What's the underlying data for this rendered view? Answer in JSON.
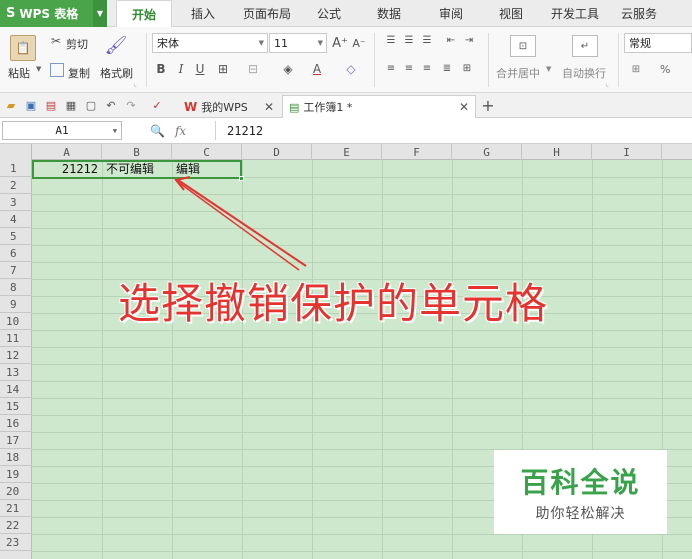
{
  "app": {
    "name": "WPS 表格",
    "logo": "S"
  },
  "menu_tabs": [
    "开始",
    "插入",
    "页面布局",
    "公式",
    "数据",
    "审阅",
    "视图",
    "开发工具",
    "云服务"
  ],
  "ribbon": {
    "cut": "剪切",
    "copy": "复制",
    "paste": "粘贴",
    "format_painter": "格式刷",
    "font_name": "宋体",
    "font_size": "11",
    "merge_center": "合并居中",
    "wrap_text": "自动换行",
    "number_format": "常规",
    "percent": "%"
  },
  "doc_tabs": [
    {
      "label": "我的WPS"
    },
    {
      "label": "工作簿1 *"
    }
  ],
  "formula_bar": {
    "name_box": "A1",
    "fx": "fx",
    "value": "21212"
  },
  "columns": [
    "A",
    "B",
    "C",
    "D",
    "E",
    "F",
    "G",
    "H",
    "I"
  ],
  "rows": [
    "1",
    "2",
    "3",
    "4",
    "5",
    "6",
    "7",
    "8",
    "9",
    "10",
    "11",
    "12",
    "13",
    "14",
    "15",
    "16",
    "17",
    "18",
    "19",
    "20",
    "21",
    "22",
    "23"
  ],
  "cells": {
    "A1": "21212",
    "B1": "不可编辑",
    "C1": "编辑"
  },
  "annotation": "选择撤销保护的单元格",
  "watermark": {
    "title": "百科全说",
    "subtitle": "助你轻松解决"
  },
  "colors": {
    "brand_green": "#4aa54a",
    "sheet_bg": "#cde8cd",
    "annotation_red": "#e3342f"
  }
}
